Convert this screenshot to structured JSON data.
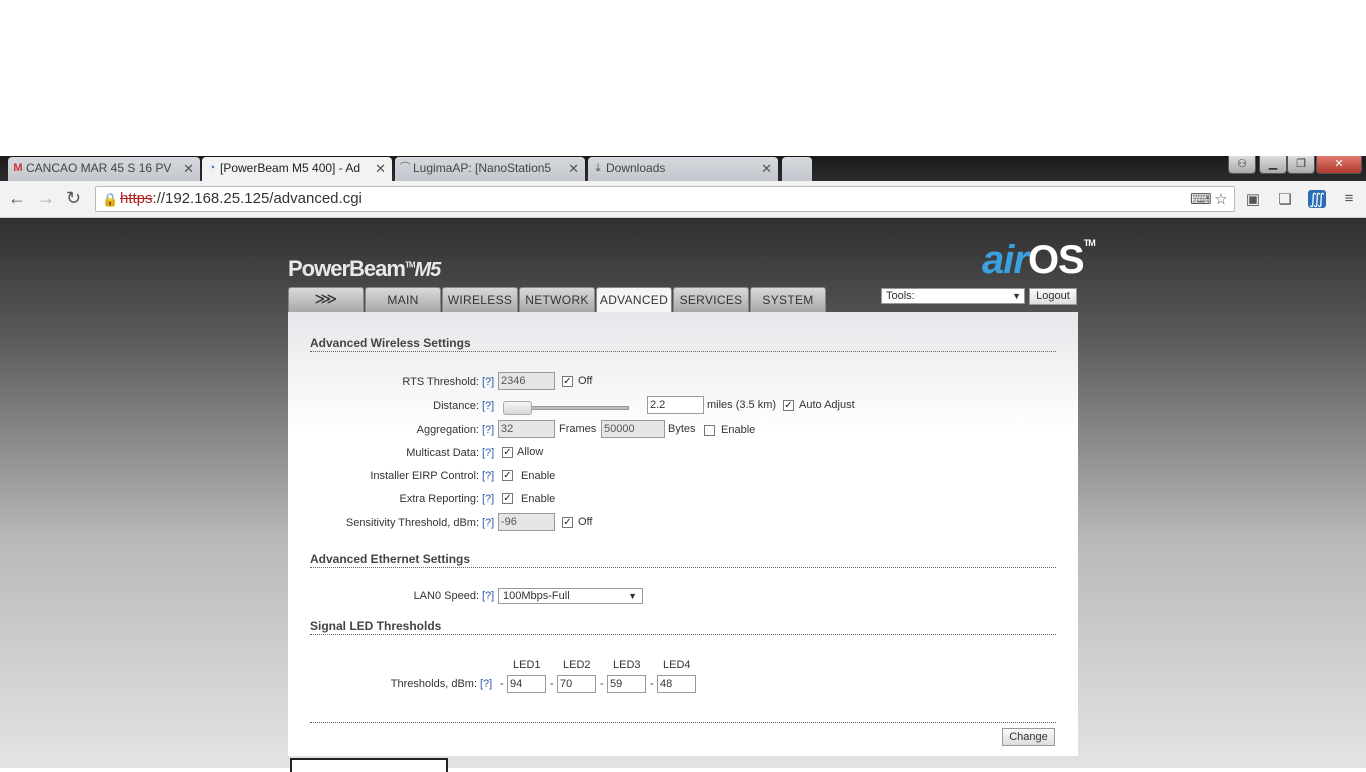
{
  "browser": {
    "tabs": [
      {
        "label": "CANCAO MAR 45 S 16 PV",
        "icon": "gmail-icon",
        "active": false
      },
      {
        "label": "[PowerBeam M5 400] - Ad",
        "icon": "wifi-icon",
        "active": true
      },
      {
        "label": "LugimaAP: [NanoStation5",
        "icon": "ubnt-icon",
        "active": false
      },
      {
        "label": "Downloads",
        "icon": "download-icon",
        "active": false
      }
    ],
    "url_protocol": "https",
    "url_rest": "://192.168.25.125/advanced.cgi"
  },
  "header": {
    "brand": "PowerBeam",
    "brand_tm": "TM",
    "brand_model": "M5",
    "logo_air": "air",
    "logo_os": "OS",
    "logo_tm": "TM"
  },
  "tabs": {
    "main": "MAIN",
    "wireless": "WIRELESS",
    "network": "NETWORK",
    "advanced": "ADVANCED",
    "services": "SERVICES",
    "system": "SYSTEM"
  },
  "tools": {
    "selected": "Tools:",
    "logout": "Logout"
  },
  "help": "[?]",
  "wireless": {
    "title": "Advanced Wireless Settings",
    "rts_label": "RTS Threshold:",
    "rts_value": "2346",
    "rts_off": "Off",
    "distance_label": "Distance:",
    "distance_value": "2.2",
    "distance_units": "miles (3.5 km)",
    "auto_adjust": "Auto Adjust",
    "aggregation_label": "Aggregation:",
    "agg_frames_value": "32",
    "frames": "Frames",
    "agg_bytes_value": "50000",
    "bytes": "Bytes",
    "agg_enable": "Enable",
    "multicast_label": "Multicast Data:",
    "multicast_allow": "Allow",
    "eirp_label": "Installer EIRP Control:",
    "eirp_enable": "Enable",
    "extra_label": "Extra Reporting:",
    "extra_enable": "Enable",
    "sens_label": "Sensitivity Threshold, dBm:",
    "sens_value": "-96",
    "sens_off": "Off"
  },
  "ethernet": {
    "title": "Advanced Ethernet Settings",
    "lan0_label": "LAN0 Speed:",
    "lan0_value": "100Mbps-Full"
  },
  "led": {
    "title": "Signal LED Thresholds",
    "headers": [
      "LED1",
      "LED2",
      "LED3",
      "LED4"
    ],
    "label": "Thresholds, dBm:",
    "dash": "-",
    "values": [
      "94",
      "70",
      "59",
      "48"
    ]
  },
  "change": "Change"
}
